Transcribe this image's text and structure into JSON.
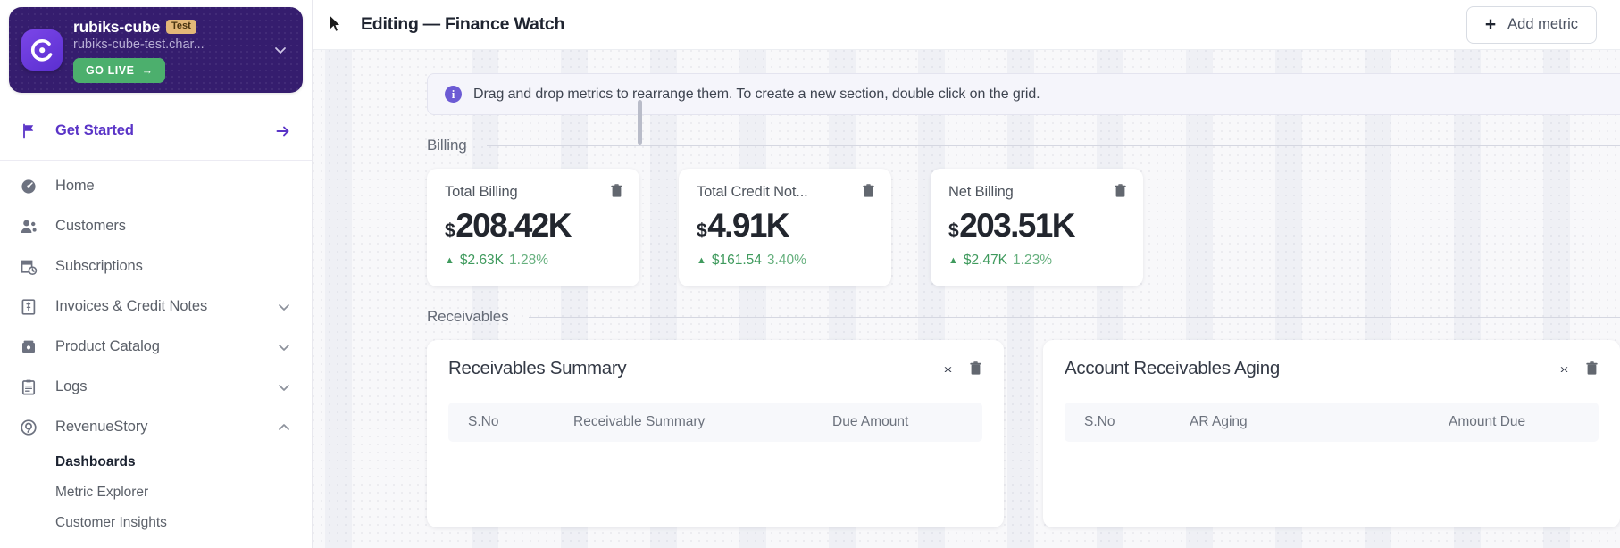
{
  "sidebar": {
    "workspace": {
      "name": "rubiks-cube",
      "badge": "Test",
      "domain": "rubiks-cube-test.char...",
      "go_live_label": "GO LIVE",
      "go_live_arrow": "→",
      "chevron_icon": "chevron-down-icon",
      "logo_icon": "chargebee-logo-icon"
    },
    "get_started": {
      "label": "Get Started",
      "icon": "flag-icon",
      "arrow": "→"
    },
    "items": [
      {
        "label": "Home",
        "icon": "speedometer-icon",
        "caret": ""
      },
      {
        "label": "Customers",
        "icon": "users-icon",
        "caret": ""
      },
      {
        "label": "Subscriptions",
        "icon": "calendar-clock-icon",
        "caret": ""
      },
      {
        "label": "Invoices & Credit Notes",
        "icon": "invoice-icon",
        "caret": "⌄"
      },
      {
        "label": "Product Catalog",
        "icon": "box-icon",
        "caret": "⌄"
      },
      {
        "label": "Logs",
        "icon": "clipboard-icon",
        "caret": "⌄"
      },
      {
        "label": "RevenueStory",
        "icon": "target-icon",
        "caret": "⌃"
      }
    ],
    "sub_items": [
      {
        "label": "Dashboards",
        "active": true
      },
      {
        "label": "Metric Explorer",
        "active": false
      },
      {
        "label": "Customer Insights",
        "active": false
      }
    ]
  },
  "header": {
    "mode": "Editing",
    "separator": "—",
    "dashboard_name": "Finance Watch",
    "add_metric_label": "Add metric",
    "plus_icon": "plus-icon"
  },
  "banner": {
    "icon": "info-icon",
    "icon_glyph": "i",
    "text": "Drag and drop metrics to rearrange them. To create a new section, double click on the grid."
  },
  "sections": [
    {
      "title": "Billing",
      "cards": [
        {
          "name": "Total Billing",
          "currency": "$",
          "value": "208.42K",
          "delta_dir": "▲",
          "delta_value": "$2.63K",
          "delta_pct": "1.28%",
          "trash_icon": "trash-icon"
        },
        {
          "name": "Total Credit Not...",
          "currency": "$",
          "value": "4.91K",
          "delta_dir": "▲",
          "delta_value": "$161.54",
          "delta_pct": "3.40%",
          "trash_icon": "trash-icon"
        },
        {
          "name": "Net Billing",
          "currency": "$",
          "value": "203.51K",
          "delta_dir": "▲",
          "delta_value": "$2.47K",
          "delta_pct": "1.23%",
          "trash_icon": "trash-icon"
        }
      ]
    },
    {
      "title": "Receivables",
      "panels": [
        {
          "title": "Receivables Summary",
          "collapse_icon": "collapse-icon",
          "collapse_glyph": "›‹",
          "trash_icon": "trash-icon",
          "columns": [
            "S.No",
            "Receivable Summary",
            "Due Amount"
          ]
        },
        {
          "title": "Account Receivables Aging",
          "collapse_icon": "collapse-icon",
          "collapse_glyph": "›‹",
          "trash_icon": "trash-icon",
          "columns": [
            "S.No",
            "AR Aging",
            "Amount Due"
          ]
        }
      ]
    }
  ],
  "colors": {
    "brand_purple": "#351d6e",
    "accent_purple": "#5a34c7",
    "go_live_green": "#4caf6d",
    "positive_green": "#3f9a5d",
    "badge_amber": "#e3b778",
    "canvas_bg": "#eff0f5"
  }
}
